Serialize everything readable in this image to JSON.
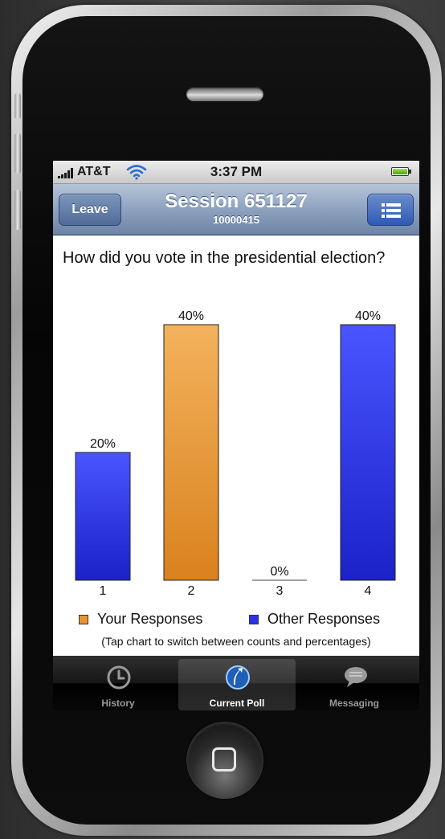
{
  "status_bar": {
    "carrier": "AT&T",
    "time": "3:37 PM"
  },
  "nav": {
    "leave_label": "Leave",
    "title": "Session 651127",
    "subtitle": "10000415"
  },
  "question": "How did you vote in the presidential election?",
  "chart_data": {
    "type": "bar",
    "categories": [
      "1",
      "2",
      "3",
      "4"
    ],
    "values": [
      20,
      40,
      0,
      40
    ],
    "value_labels": [
      "20%",
      "40%",
      "0%",
      "40%"
    ],
    "bar_groups": [
      "other",
      "your",
      "other",
      "other"
    ],
    "ylim": [
      0,
      40
    ],
    "grid": false,
    "legend": [
      {
        "name": "Your Responses",
        "color": "#e8952f"
      },
      {
        "name": "Other Responses",
        "color": "#2a33e6"
      }
    ],
    "legend_position": "bottom"
  },
  "hint": "(Tap chart to switch between counts and percentages)",
  "tabs": [
    {
      "label": "History",
      "icon": "clock-icon",
      "active": false
    },
    {
      "label": "Current Poll",
      "icon": "poll-icon",
      "active": true
    },
    {
      "label": "Messaging",
      "icon": "chat-bubble-icon",
      "active": false
    }
  ],
  "colors": {
    "your_responses": "#e8952f",
    "other_responses": "#2a33e6",
    "nav_bar": "#8ea2bf"
  }
}
